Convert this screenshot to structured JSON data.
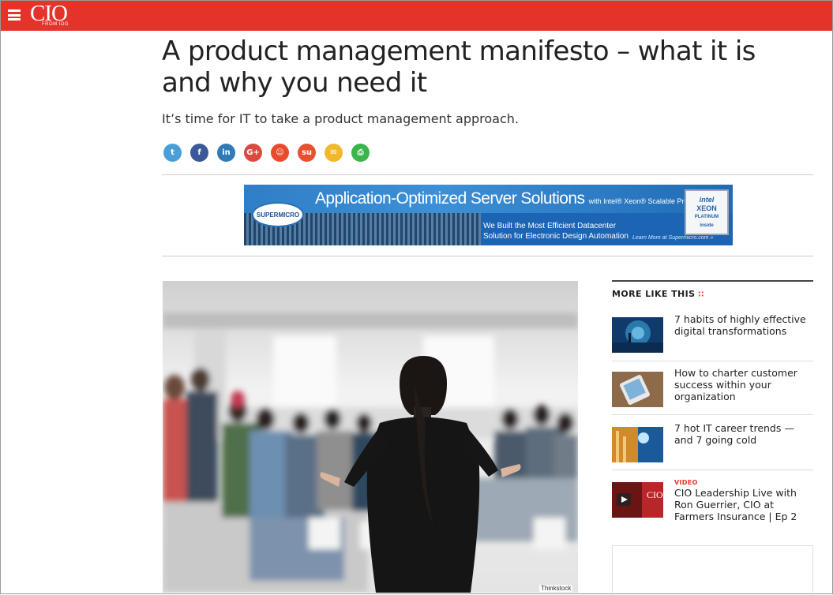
{
  "header": {
    "logo": "CIO",
    "logo_sub": "FROM IDG",
    "brand_color": "#e5332a"
  },
  "article": {
    "headline": "A product management manifesto – what it is and why you need it",
    "dek": "It’s time for IT to take a product management approach.",
    "image_credit": "Thinkstock"
  },
  "share": [
    {
      "name": "twitter-icon",
      "glyph": "t",
      "color": "#4a9fd8"
    },
    {
      "name": "facebook-icon",
      "glyph": "f",
      "color": "#3b5998"
    },
    {
      "name": "linkedin-icon",
      "glyph": "in",
      "color": "#2f7ab7"
    },
    {
      "name": "google-plus-icon",
      "glyph": "G+",
      "color": "#dc4a3d"
    },
    {
      "name": "reddit-icon",
      "glyph": "☺",
      "color": "#e84a2b"
    },
    {
      "name": "stumbleupon-icon",
      "glyph": "su",
      "color": "#e8502f"
    },
    {
      "name": "email-icon",
      "glyph": "✉",
      "color": "#f1b82b"
    },
    {
      "name": "print-icon",
      "glyph": "⎙",
      "color": "#3ab54a"
    }
  ],
  "ad": {
    "brand": "SUPERMICRO",
    "title": "Application-Optimized Server Solutions",
    "title_sub": "with Intel® Xeon® Scalable Processors",
    "tagline_1": "We Built the Most Efficient Datacenter",
    "tagline_2": "Solution for Electronic Design Automation",
    "learn_more": "Learn More at Supermicro.com »",
    "chip_1": "intel",
    "chip_2": "XEON",
    "chip_3": "PLATINUM",
    "chip_4": "inside"
  },
  "sidebar": {
    "heading": "MORE LIKE THIS",
    "items": [
      {
        "label": "7 habits of highly effective digital transformations",
        "tag": ""
      },
      {
        "label": "How to charter customer success within your organization",
        "tag": ""
      },
      {
        "label": "7 hot IT career trends — and 7 going cold",
        "tag": ""
      },
      {
        "label": "CIO Leadership Live with Ron Guerrier, CIO at Farmers Insurance | Ep 2",
        "tag": "VIDEO"
      }
    ]
  }
}
